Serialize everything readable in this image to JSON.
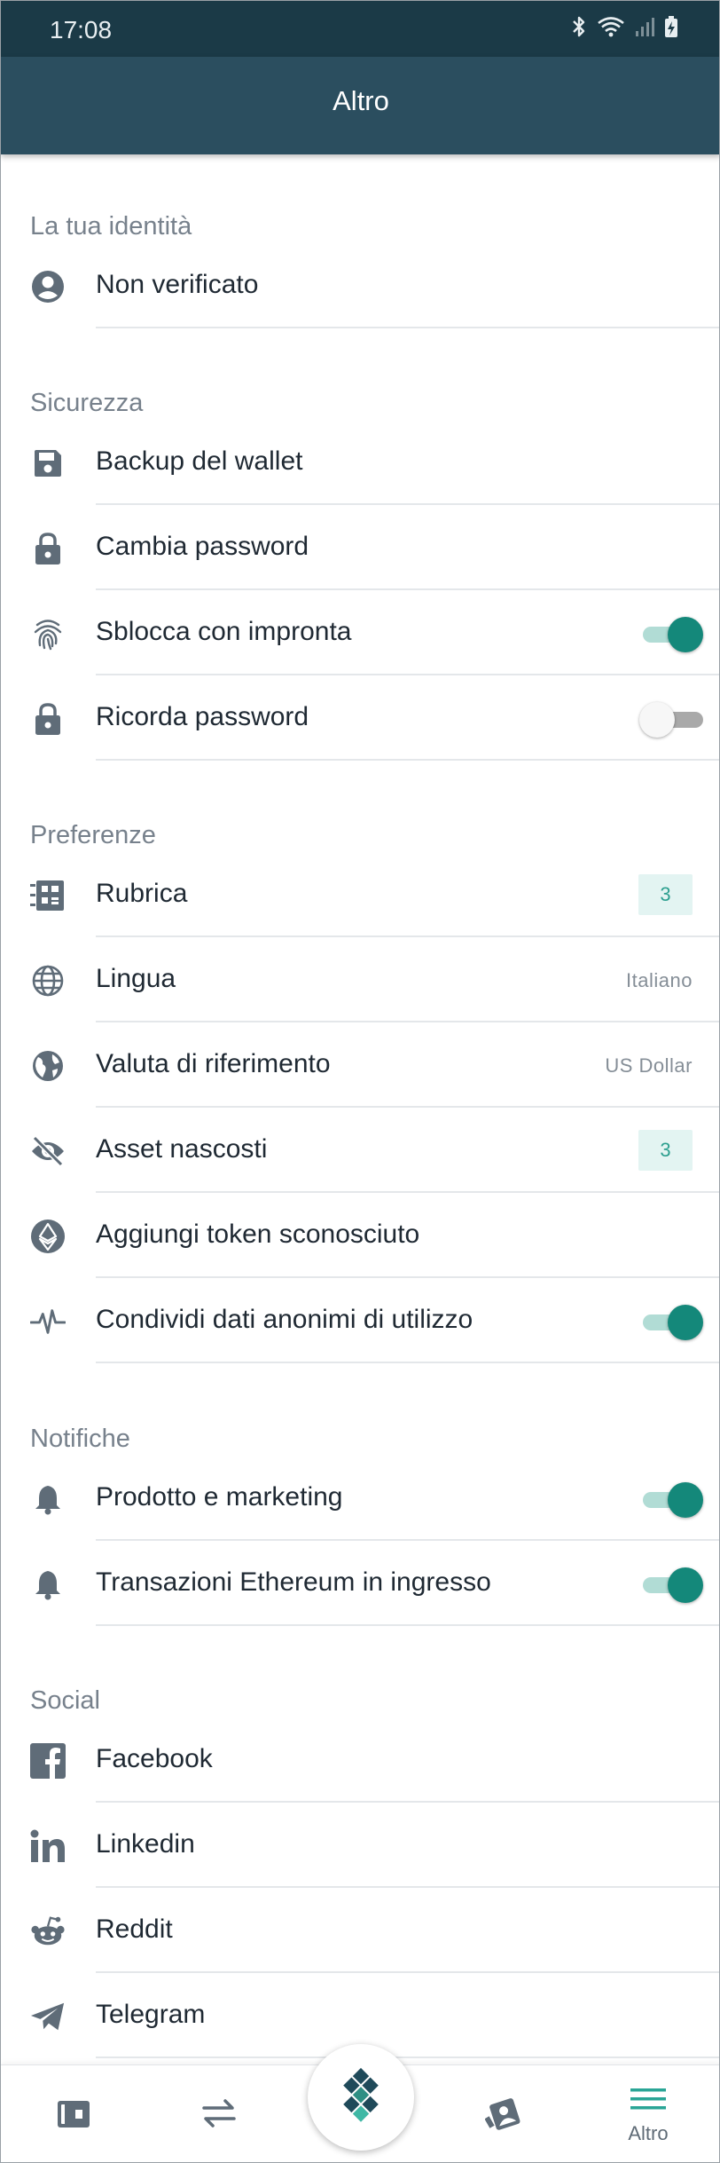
{
  "status_bar": {
    "time": "17:08"
  },
  "header": {
    "title": "Altro"
  },
  "colors": {
    "header_bg": "#2b4e5f",
    "status_bg": "#1b3a47",
    "accent": "#14887a",
    "badge_bg": "#e3f4f2"
  },
  "sections": [
    {
      "title": "La tua identità",
      "items": [
        {
          "label": "Non verificato",
          "icon": "account-circle-icon"
        }
      ]
    },
    {
      "title": "Sicurezza",
      "items": [
        {
          "label": "Backup del wallet",
          "icon": "save-floppy-icon"
        },
        {
          "label": "Cambia password",
          "icon": "lock-icon"
        },
        {
          "label": "Sblocca con impronta",
          "icon": "fingerprint-icon",
          "toggle": true
        },
        {
          "label": "Ricorda password",
          "icon": "lock-icon",
          "toggle": false
        }
      ]
    },
    {
      "title": "Preferenze",
      "items": [
        {
          "label": "Rubrica",
          "icon": "address-book-icon",
          "badge": "3"
        },
        {
          "label": "Lingua",
          "icon": "globe-icon",
          "value": "Italiano"
        },
        {
          "label": "Valuta di riferimento",
          "icon": "earth-icon",
          "value": "US Dollar"
        },
        {
          "label": "Asset nascosti",
          "icon": "eye-off-icon",
          "badge": "3"
        },
        {
          "label": "Aggiungi token sconosciuto",
          "icon": "ethereum-icon"
        },
        {
          "label": "Condividi dati anonimi di utilizzo",
          "icon": "pulse-icon",
          "toggle": true
        }
      ]
    },
    {
      "title": "Notifiche",
      "items": [
        {
          "label": "Prodotto e marketing",
          "icon": "bell-icon",
          "toggle": true
        },
        {
          "label": "Transazioni Ethereum in ingresso",
          "icon": "bell-icon",
          "toggle": true
        }
      ]
    },
    {
      "title": "Social",
      "items": [
        {
          "label": "Facebook",
          "icon": "facebook-icon"
        },
        {
          "label": "Linkedin",
          "icon": "linkedin-icon"
        },
        {
          "label": "Reddit",
          "icon": "reddit-icon"
        },
        {
          "label": "Telegram",
          "icon": "telegram-icon"
        }
      ]
    }
  ],
  "bottom_nav": {
    "items": [
      {
        "icon": "wallet-icon"
      },
      {
        "icon": "swap-arrows-icon"
      },
      {
        "icon": "app-logo-icon"
      },
      {
        "icon": "cards-icon"
      },
      {
        "icon": "menu-icon",
        "label": "Altro",
        "active": true
      }
    ]
  }
}
